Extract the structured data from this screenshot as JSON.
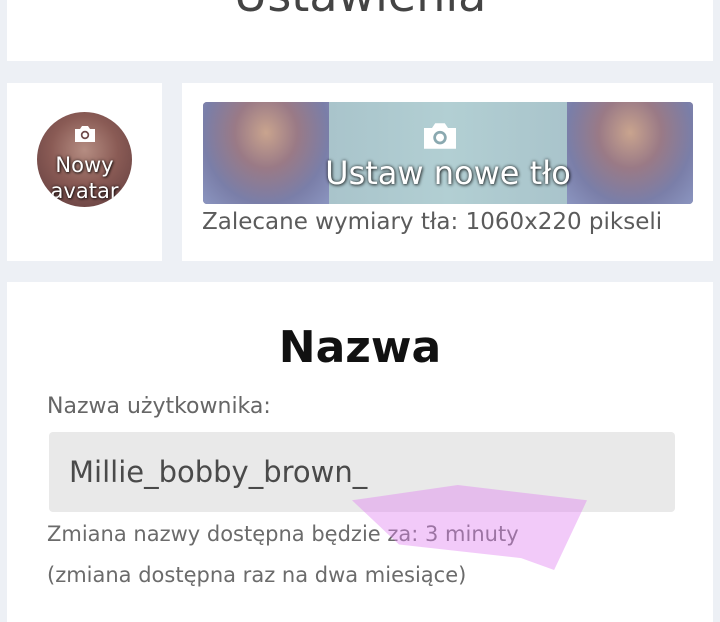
{
  "header": {
    "title": "Ustawienia"
  },
  "avatar": {
    "label_line1": "Nowy",
    "label_line2": "avatar",
    "icon": "camera-icon"
  },
  "background": {
    "label": "Ustaw nowe tło",
    "icon": "camera-icon",
    "hint": "Zalecane wymiary tła: 1060x220 pikseli"
  },
  "name_section": {
    "title": "Nazwa",
    "field_label": "Nazwa użytkownika:",
    "username_value": "Millie_bobby_brown_",
    "change_info": "Zmiana nazwy dostępna będzie za: 3 minuty",
    "change_note": "(zmiana dostępna raz na dwa miesiące)"
  },
  "colors": {
    "page_background": "#edf0f5",
    "card_background": "#ffffff",
    "input_background": "#e9e9e9",
    "highlight_marker": "#e080f0"
  }
}
